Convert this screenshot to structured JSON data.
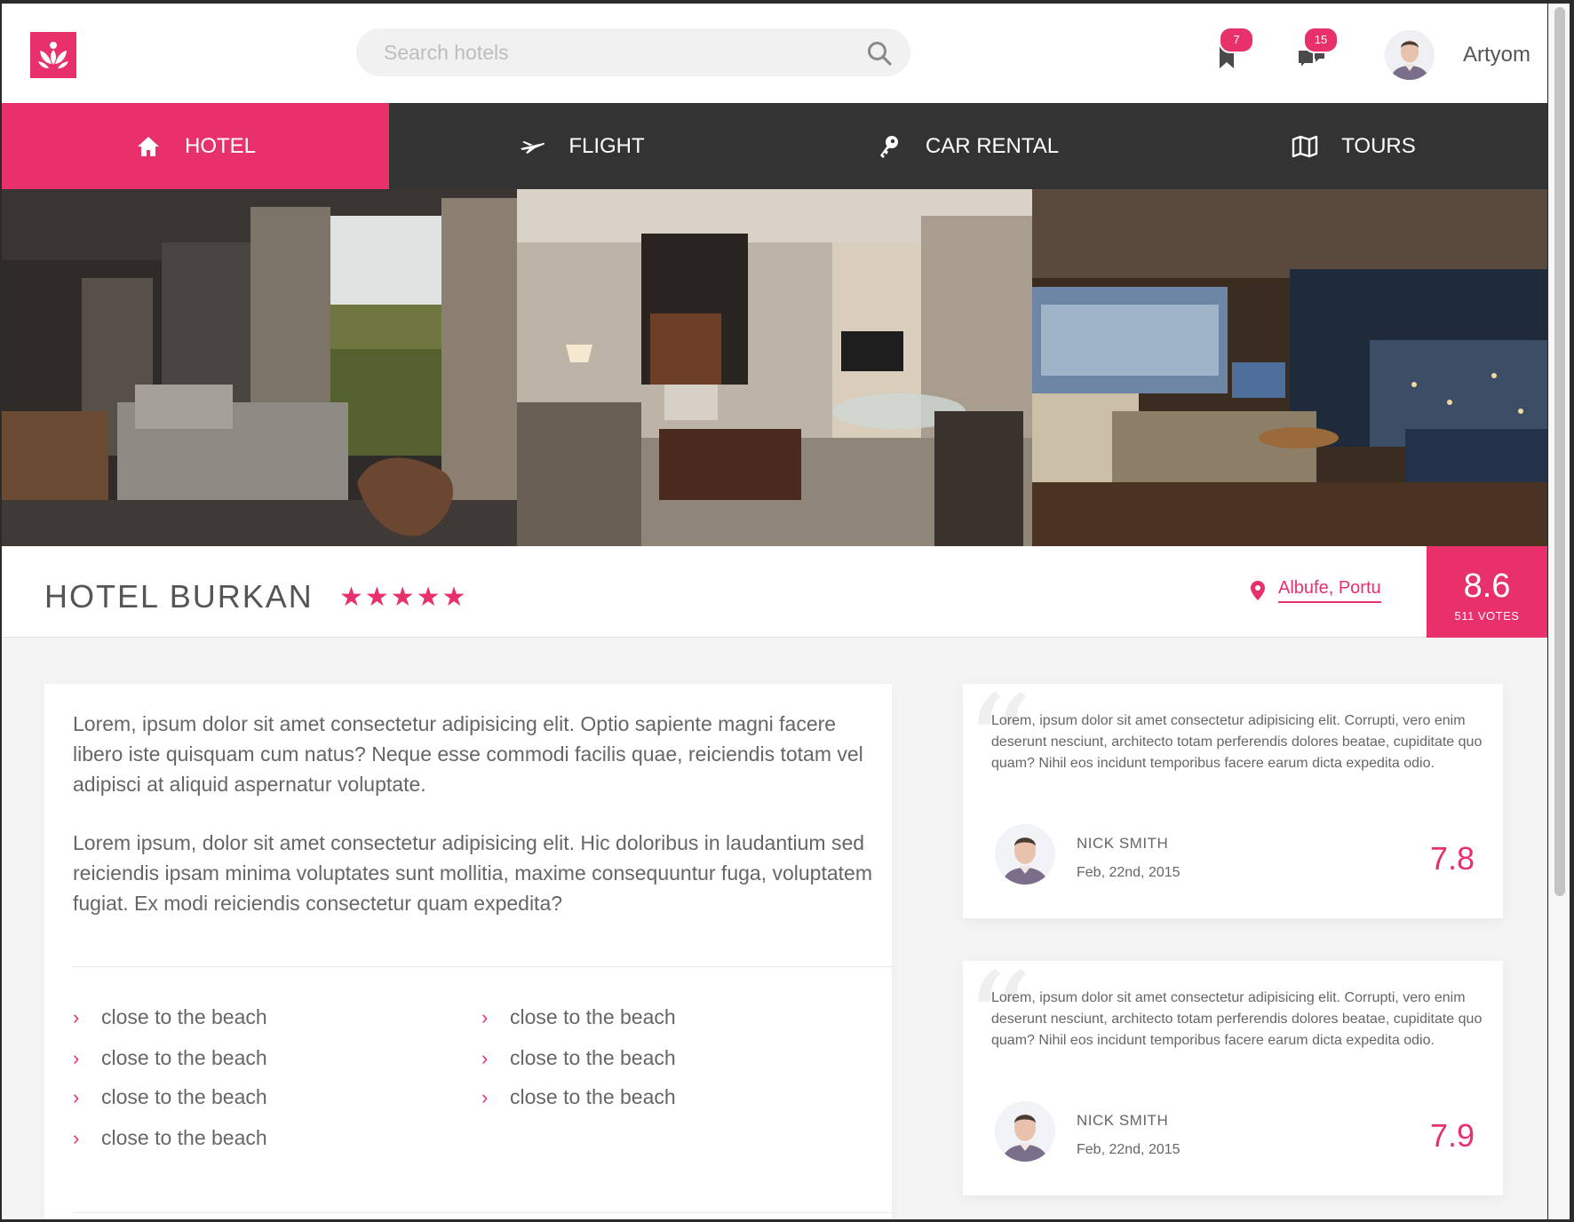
{
  "search": {
    "placeholder": "Search hotels"
  },
  "header": {
    "bookmarks_badge": "7",
    "messages_badge": "15",
    "user_name": "Artyom"
  },
  "nav": {
    "items": [
      {
        "label": "HOTEL",
        "icon": "home-icon",
        "active": true
      },
      {
        "label": "FLIGHT",
        "icon": "plane-icon",
        "active": false
      },
      {
        "label": "CAR RENTAL",
        "icon": "key-icon",
        "active": false
      },
      {
        "label": "TOURS",
        "icon": "map-icon",
        "active": false
      }
    ]
  },
  "hotel": {
    "name": "HOTEL BURKAN",
    "stars": "★★★★★",
    "star_count": 5,
    "location": "Albufe, Portu",
    "score": "8.6",
    "votes": "511 VOTES"
  },
  "description": {
    "paragraphs": [
      "Lorem, ipsum dolor sit amet consectetur adipisicing elit. Optio sapiente magni facere libero iste quisquam cum natus? Neque esse commodi facilis quae, reiciendis totam vel adipisci at aliquid aspernatur voluptate.",
      "Lorem ipsum, dolor sit amet consectetur adipisicing elit. Hic doloribus in laudantium sed reiciendis ipsam minima voluptates sunt mollitia, maxime consequuntur fuga, voluptatem fugiat. Ex modi reiciendis consectetur quam expedita?"
    ],
    "features_left": [
      "close to the beach",
      "close to the beach",
      "close to the beach",
      "close to the beach"
    ],
    "features_right": [
      "close to the beach",
      "close to the beach",
      "close to the beach"
    ]
  },
  "reviews": [
    {
      "text": "Lorem, ipsum dolor sit amet consectetur adipisicing elit. Corrupti, vero enim deserunt nesciunt, architecto totam perferendis dolores beatae, cupiditate quo quam? Nihil eos incidunt temporibus facere earum dicta expedita odio.",
      "name": "NICK SMITH",
      "date": "Feb, 22nd, 2015",
      "score": "7.8"
    },
    {
      "text": "Lorem, ipsum dolor sit amet consectetur adipisicing elit. Corrupti, vero enim deserunt nesciunt, architecto totam perferendis dolores beatae, cupiditate quo quam? Nihil eos incidunt temporibus facere earum dicta expedita odio.",
      "name": "NICK SMITH",
      "date": "Feb, 22nd, 2015",
      "score": "7.9"
    }
  ],
  "colors": {
    "accent": "#e8316a",
    "nav_bg": "#333333",
    "page_bg": "#f4f4f4"
  }
}
